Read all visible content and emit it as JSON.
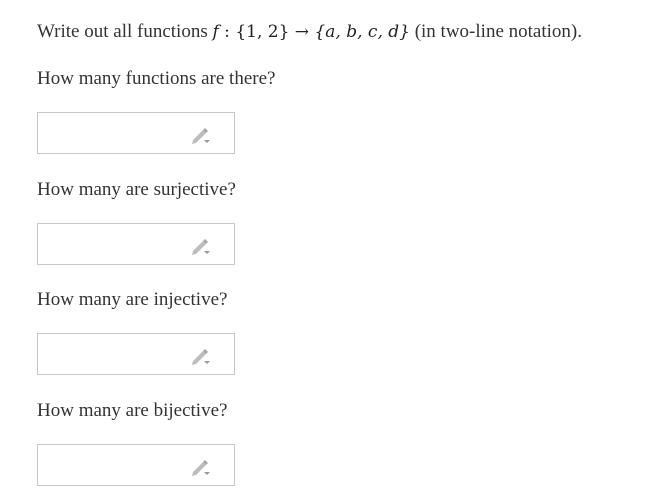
{
  "prompt": {
    "lead": "Write out all functions ",
    "f": "f",
    "colon": " : ",
    "domain_set": "{1, 2}",
    "arrow": " → ",
    "codomain_set": "{a, b, c, d}",
    "tail": " (in two-line notation)."
  },
  "questions": [
    {
      "label": "How many functions are there?",
      "value": ""
    },
    {
      "label": "How many are surjective?",
      "value": ""
    },
    {
      "label": "How many are injective?",
      "value": ""
    },
    {
      "label": "How many are bijective?",
      "value": ""
    }
  ],
  "icons": {
    "answer_field_icon": "pencil-icon"
  },
  "colors": {
    "text": "#333333",
    "box_border": "#c8c8c8",
    "icon": "#b5b5b5"
  }
}
